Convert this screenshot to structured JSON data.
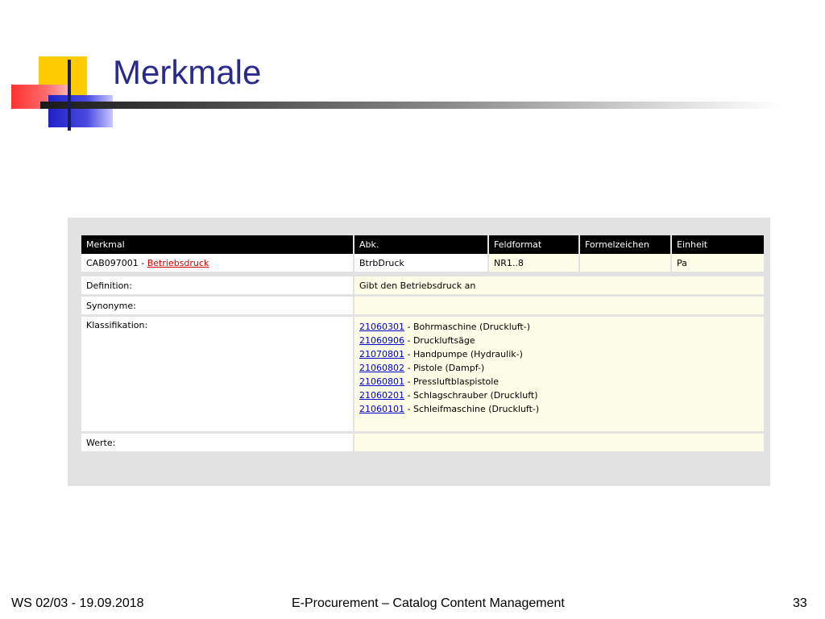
{
  "slide": {
    "title": "Merkmale",
    "footer_left": "WS 02/03 - 19.09.2018",
    "footer_center": "E-Procurement – Catalog Content Management",
    "page_number": "33"
  },
  "table": {
    "headers": [
      "Merkmal",
      "Abk.",
      "Feldformat",
      "Formelzeichen",
      "Einheit"
    ],
    "row": {
      "id": "CAB097001",
      "separator": " - ",
      "name": "Betriebsdruck",
      "abbr": "BtrbDruck",
      "format": "NR1..8",
      "formula": "",
      "unit": "Pa"
    },
    "definition_label": "Definition:",
    "definition_value": "Gibt den Betriebsdruck an",
    "synonyme_label": "Synonyme:",
    "synonyme_value": "",
    "klassifikation_label": "Klassifikation:",
    "klassifikation": [
      {
        "code": "21060301",
        "text": " - Bohrmaschine (Druckluft-)"
      },
      {
        "code": "21060906",
        "text": " - Druckluftsäge"
      },
      {
        "code": "21070801",
        "text": " - Handpumpe (Hydraulik-)"
      },
      {
        "code": "21060802",
        "text": " - Pistole (Dampf-)"
      },
      {
        "code": "21060801",
        "text": " - Pressluftblaspistole"
      },
      {
        "code": "21060201",
        "text": " - Schlagschrauber (Druckluft)"
      },
      {
        "code": "21060101",
        "text": " - Schleifmaschine (Druckluft-)"
      }
    ],
    "werte_label": "Werte:",
    "werte_value": ""
  }
}
